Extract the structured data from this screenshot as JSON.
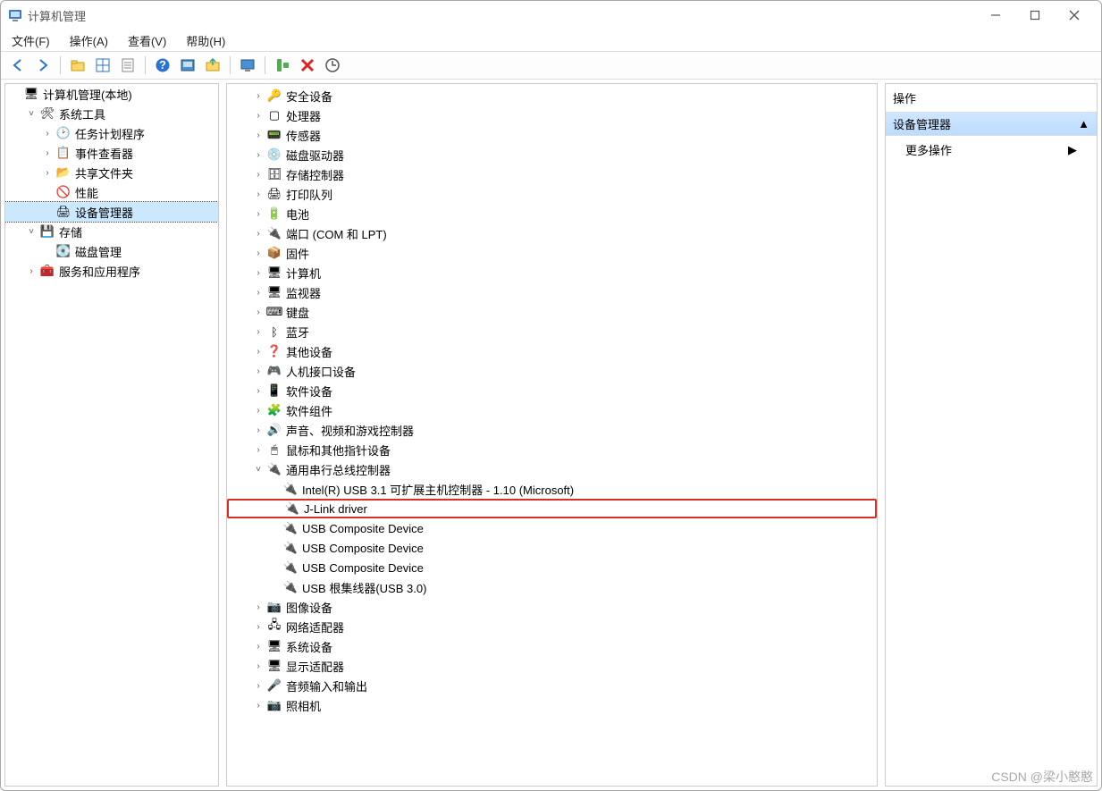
{
  "window": {
    "title": "计算机管理"
  },
  "menu": {
    "items": [
      "文件(F)",
      "操作(A)",
      "查看(V)",
      "帮助(H)"
    ]
  },
  "toolbar_icons": [
    "back",
    "forward",
    "sep",
    "folder-up",
    "grid",
    "props",
    "sep",
    "help",
    "console",
    "export",
    "sep",
    "monitor",
    "sep",
    "device-add",
    "device-remove",
    "device-update"
  ],
  "left_tree": [
    {
      "depth": 0,
      "twisty": "",
      "icon": "mgr",
      "label": "计算机管理(本地)"
    },
    {
      "depth": 1,
      "twisty": "v",
      "icon": "tools",
      "label": "系统工具"
    },
    {
      "depth": 2,
      "twisty": ">",
      "icon": "clock",
      "label": "任务计划程序"
    },
    {
      "depth": 2,
      "twisty": ">",
      "icon": "event",
      "label": "事件查看器"
    },
    {
      "depth": 2,
      "twisty": ">",
      "icon": "share",
      "label": "共享文件夹"
    },
    {
      "depth": 2,
      "twisty": "",
      "icon": "perf",
      "label": "性能"
    },
    {
      "depth": 2,
      "twisty": "",
      "icon": "devmgr",
      "label": "设备管理器",
      "selected": true
    },
    {
      "depth": 1,
      "twisty": "v",
      "icon": "storage",
      "label": "存储"
    },
    {
      "depth": 2,
      "twisty": "",
      "icon": "disk",
      "label": "磁盘管理"
    },
    {
      "depth": 1,
      "twisty": ">",
      "icon": "svc",
      "label": "服务和应用程序"
    }
  ],
  "device_tree": [
    {
      "depth": 0,
      "twisty": ">",
      "icon": "security",
      "label": "安全设备"
    },
    {
      "depth": 0,
      "twisty": ">",
      "icon": "cpu",
      "label": "处理器"
    },
    {
      "depth": 0,
      "twisty": ">",
      "icon": "sensor",
      "label": "传感器"
    },
    {
      "depth": 0,
      "twisty": ">",
      "icon": "diskdrv",
      "label": "磁盘驱动器"
    },
    {
      "depth": 0,
      "twisty": ">",
      "icon": "storagectl",
      "label": "存储控制器"
    },
    {
      "depth": 0,
      "twisty": ">",
      "icon": "printer",
      "label": "打印队列"
    },
    {
      "depth": 0,
      "twisty": ">",
      "icon": "battery",
      "label": "电池"
    },
    {
      "depth": 0,
      "twisty": ">",
      "icon": "port",
      "label": "端口 (COM 和 LPT)"
    },
    {
      "depth": 0,
      "twisty": ">",
      "icon": "firmware",
      "label": "固件"
    },
    {
      "depth": 0,
      "twisty": ">",
      "icon": "computer",
      "label": "计算机"
    },
    {
      "depth": 0,
      "twisty": ">",
      "icon": "monitor",
      "label": "监视器"
    },
    {
      "depth": 0,
      "twisty": ">",
      "icon": "keyboard",
      "label": "键盘"
    },
    {
      "depth": 0,
      "twisty": ">",
      "icon": "bluetooth",
      "label": "蓝牙"
    },
    {
      "depth": 0,
      "twisty": ">",
      "icon": "other",
      "label": "其他设备"
    },
    {
      "depth": 0,
      "twisty": ">",
      "icon": "hid",
      "label": "人机接口设备"
    },
    {
      "depth": 0,
      "twisty": ">",
      "icon": "softdev",
      "label": "软件设备"
    },
    {
      "depth": 0,
      "twisty": ">",
      "icon": "softcomp",
      "label": "软件组件"
    },
    {
      "depth": 0,
      "twisty": ">",
      "icon": "sound",
      "label": "声音、视频和游戏控制器"
    },
    {
      "depth": 0,
      "twisty": ">",
      "icon": "mouse",
      "label": "鼠标和其他指针设备"
    },
    {
      "depth": 0,
      "twisty": "v",
      "icon": "usb",
      "label": "通用串行总线控制器"
    },
    {
      "depth": 1,
      "twisty": "",
      "icon": "usb",
      "label": "Intel(R) USB 3.1 可扩展主机控制器 - 1.10 (Microsoft)"
    },
    {
      "depth": 1,
      "twisty": "",
      "icon": "usb",
      "label": "J-Link driver",
      "highlight": true
    },
    {
      "depth": 1,
      "twisty": "",
      "icon": "usb",
      "label": "USB Composite Device"
    },
    {
      "depth": 1,
      "twisty": "",
      "icon": "usb",
      "label": "USB Composite Device"
    },
    {
      "depth": 1,
      "twisty": "",
      "icon": "usb",
      "label": "USB Composite Device"
    },
    {
      "depth": 1,
      "twisty": "",
      "icon": "usb",
      "label": "USB 根集线器(USB 3.0)"
    },
    {
      "depth": 0,
      "twisty": ">",
      "icon": "image",
      "label": "图像设备"
    },
    {
      "depth": 0,
      "twisty": ">",
      "icon": "network",
      "label": "网络适配器"
    },
    {
      "depth": 0,
      "twisty": ">",
      "icon": "system",
      "label": "系统设备"
    },
    {
      "depth": 0,
      "twisty": ">",
      "icon": "display",
      "label": "显示适配器"
    },
    {
      "depth": 0,
      "twisty": ">",
      "icon": "audioio",
      "label": "音频输入和输出"
    },
    {
      "depth": 0,
      "twisty": ">",
      "icon": "camera",
      "label": "照相机"
    }
  ],
  "actions": {
    "title": "操作",
    "section": "设备管理器",
    "more": "更多操作"
  },
  "watermark": "CSDN @梁小憨憨",
  "icons": {
    "mgr": "🖥",
    "tools": "🛠",
    "clock": "🕑",
    "event": "📋",
    "share": "📂",
    "perf": "🚫",
    "devmgr": "🖨",
    "storage": "💾",
    "disk": "💽",
    "svc": "🧰",
    "security": "🔑",
    "cpu": "▢",
    "sensor": "📟",
    "diskdrv": "💿",
    "storagectl": "🗄",
    "printer": "🖨",
    "battery": "🔋",
    "port": "🔌",
    "firmware": "📦",
    "computer": "🖥",
    "monitor": "🖥",
    "keyboard": "⌨",
    "bluetooth": "ᛒ",
    "other": "❓",
    "hid": "🎮",
    "softdev": "📱",
    "softcomp": "🧩",
    "sound": "🔊",
    "mouse": "🖱",
    "usb": "🔌",
    "image": "📷",
    "network": "🖧",
    "system": "🖥",
    "display": "🖥",
    "audioio": "🎤",
    "camera": "📷"
  }
}
